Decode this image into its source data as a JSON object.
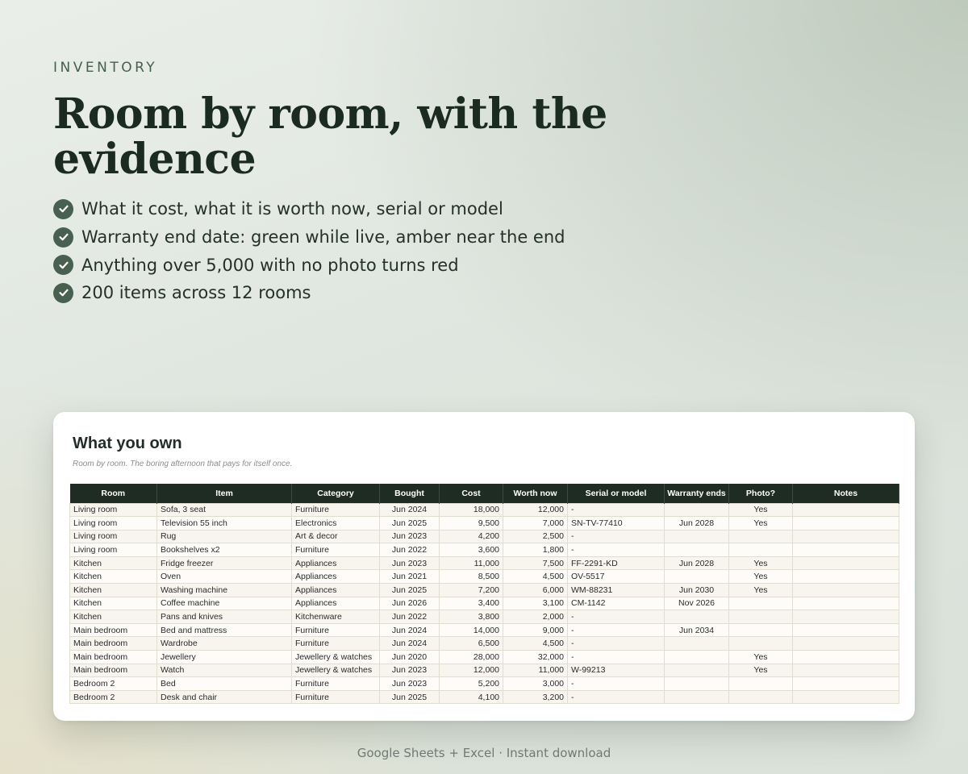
{
  "hero": {
    "eyebrow": "INVENTORY",
    "headline": "Room by room, with the evidence",
    "bullets": [
      "What it cost, what it is worth now, serial or model",
      "Warranty end date: green while live, amber near the end",
      "Anything over 5,000 with no photo turns red",
      "200 items across 12 rooms"
    ]
  },
  "sheet": {
    "title": "What you own",
    "subtitle": "Room by room. The boring afternoon that pays for itself once.",
    "columns": [
      "Room",
      "Item",
      "Category",
      "Bought",
      "Cost",
      "Worth now",
      "Serial or model",
      "Warranty ends",
      "Photo?",
      "Notes"
    ],
    "rows": [
      [
        "Living room",
        "Sofa, 3 seat",
        "Furniture",
        "Jun 2024",
        "18,000",
        "12,000",
        "-",
        "",
        "Yes",
        ""
      ],
      [
        "Living room",
        "Television 55 inch",
        "Electronics",
        "Jun 2025",
        "9,500",
        "7,000",
        "SN-TV-77410",
        "Jun 2028",
        "Yes",
        ""
      ],
      [
        "Living room",
        "Rug",
        "Art & decor",
        "Jun 2023",
        "4,200",
        "2,500",
        "-",
        "",
        "",
        ""
      ],
      [
        "Living room",
        "Bookshelves x2",
        "Furniture",
        "Jun 2022",
        "3,600",
        "1,800",
        "-",
        "",
        "",
        ""
      ],
      [
        "Kitchen",
        "Fridge freezer",
        "Appliances",
        "Jun 2023",
        "11,000",
        "7,500",
        "FF-2291-KD",
        "Jun 2028",
        "Yes",
        ""
      ],
      [
        "Kitchen",
        "Oven",
        "Appliances",
        "Jun 2021",
        "8,500",
        "4,500",
        "OV-5517",
        "",
        "Yes",
        ""
      ],
      [
        "Kitchen",
        "Washing machine",
        "Appliances",
        "Jun 2025",
        "7,200",
        "6,000",
        "WM-88231",
        "Jun 2030",
        "Yes",
        ""
      ],
      [
        "Kitchen",
        "Coffee machine",
        "Appliances",
        "Jun 2026",
        "3,400",
        "3,100",
        "CM-1142",
        "Nov 2026",
        "",
        ""
      ],
      [
        "Kitchen",
        "Pans and knives",
        "Kitchenware",
        "Jun 2022",
        "3,800",
        "2,000",
        "-",
        "",
        "",
        ""
      ],
      [
        "Main bedroom",
        "Bed and mattress",
        "Furniture",
        "Jun 2024",
        "14,000",
        "9,000",
        "-",
        "Jun 2034",
        "",
        ""
      ],
      [
        "Main bedroom",
        "Wardrobe",
        "Furniture",
        "Jun 2024",
        "6,500",
        "4,500",
        "-",
        "",
        "",
        ""
      ],
      [
        "Main bedroom",
        "Jewellery",
        "Jewellery & watches",
        "Jun 2020",
        "28,000",
        "32,000",
        "-",
        "",
        "Yes",
        ""
      ],
      [
        "Main bedroom",
        "Watch",
        "Jewellery & watches",
        "Jun 2023",
        "12,000",
        "11,000",
        "W-99213",
        "",
        "Yes",
        ""
      ],
      [
        "Bedroom 2",
        "Bed",
        "Furniture",
        "Jun 2023",
        "5,200",
        "3,000",
        "-",
        "",
        "",
        ""
      ],
      [
        "Bedroom 2",
        "Desk and chair",
        "Furniture",
        "Jun 2025",
        "4,100",
        "3,200",
        "-",
        "",
        "",
        ""
      ]
    ]
  },
  "footer": {
    "text": "Google Sheets + Excel  ·  Instant download"
  },
  "colors": {
    "accent": "#48604f",
    "header_bg": "#1f2c24",
    "headline": "#1b2b21"
  },
  "icons": {
    "bullet": "check-circle-icon"
  }
}
